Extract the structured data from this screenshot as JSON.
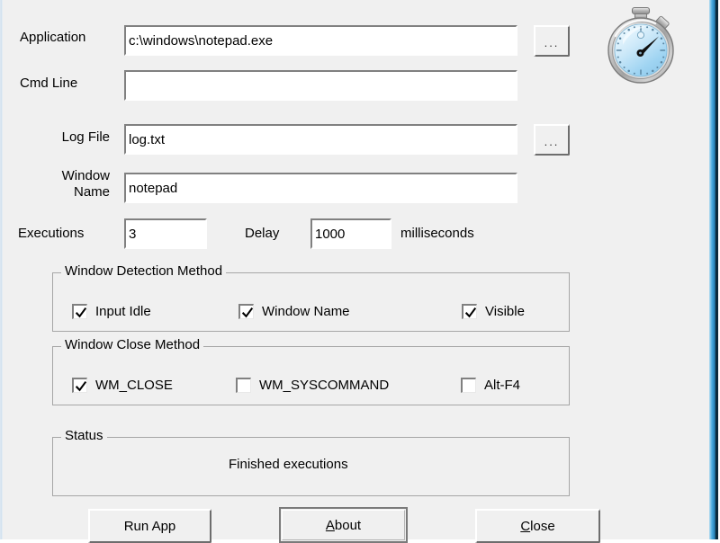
{
  "window": {
    "background_color": "#f0f0f0",
    "border_accent_color": "#49a9dd"
  },
  "form": {
    "fields": [
      {
        "label": "Application",
        "value": "c:\\windows\\notepad.exe",
        "placeholder": "",
        "has_browse_button": true,
        "browse_label": "..."
      },
      {
        "label": "Cmd Line",
        "value": "",
        "placeholder": "",
        "has_browse_button": false,
        "browse_label": ""
      },
      {
        "label": "Log File",
        "value": "log.txt",
        "placeholder": "",
        "has_browse_button": true,
        "browse_label": "..."
      },
      {
        "label": "Window\nName",
        "value": "notepad",
        "placeholder": "",
        "has_browse_button": false,
        "browse_label": ""
      }
    ],
    "executions": {
      "label": "Executions",
      "value": "3"
    },
    "delay": {
      "label": "Delay",
      "value": "1000",
      "units": "milliseconds"
    }
  },
  "detection_group": {
    "title": "Window Detection Method",
    "options": [
      {
        "label": "Input Idle",
        "checked": true
      },
      {
        "label": "Window Name",
        "checked": true
      },
      {
        "label": "Visible",
        "checked": true
      }
    ]
  },
  "close_group": {
    "title": "Window Close Method",
    "options": [
      {
        "label": "WM_CLOSE",
        "checked": true
      },
      {
        "label": "WM_SYSCOMMAND",
        "checked": false
      },
      {
        "label": "Alt-F4",
        "checked": false
      }
    ]
  },
  "status_group": {
    "title": "Status",
    "message": "Finished executions"
  },
  "buttons": {
    "run": {
      "label": "Run App",
      "accel": "",
      "default": false
    },
    "about": {
      "label": "bout",
      "accel": "A",
      "default": true
    },
    "close": {
      "label": "lose",
      "accel": "C",
      "default": false
    }
  },
  "icons": {
    "stopwatch": "stopwatch-icon",
    "browse": "ellipsis-icon",
    "check": "checkmark-icon"
  }
}
